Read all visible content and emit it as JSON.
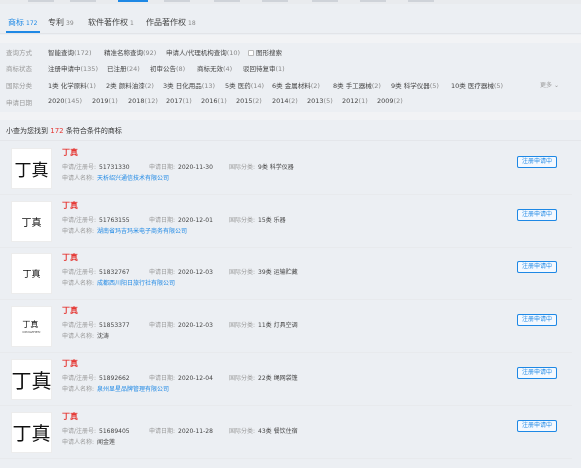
{
  "tabs": [
    {
      "label": "商标",
      "count": "172"
    },
    {
      "label": "专利",
      "count": "39"
    },
    {
      "label": "软件著作权",
      "count": "1"
    },
    {
      "label": "作品著作权",
      "count": "18"
    }
  ],
  "filters": {
    "query_mode": {
      "label": "查询方式",
      "options": [
        {
          "label": "智能查询",
          "count": "(172)"
        },
        {
          "label": "精准名称查询",
          "count": "(92)"
        },
        {
          "label": "申请人/代理机构查询",
          "count": "(10)"
        }
      ],
      "checkbox_label": "图形搜索"
    },
    "status": {
      "label": "商标状态",
      "options": [
        {
          "label": "注册申请中",
          "count": "(135)"
        },
        {
          "label": "已注册",
          "count": "(24)"
        },
        {
          "label": "初审公告",
          "count": "(8)"
        },
        {
          "label": "商标无效",
          "count": "(4)"
        },
        {
          "label": "驳回待复审",
          "count": "(1)"
        }
      ]
    },
    "class": {
      "label": "国际分类",
      "options": [
        {
          "label": "1类 化学原料",
          "count": "(1)"
        },
        {
          "label": "2类 颜料油漆",
          "count": "(2)"
        },
        {
          "label": "3类 日化用品",
          "count": "(13)"
        },
        {
          "label": "5类 医药",
          "count": "(14)"
        },
        {
          "label": "6类 金属材料",
          "count": "(2)"
        },
        {
          "label": "8类 手工器械",
          "count": "(2)"
        },
        {
          "label": "9类 科学仪器",
          "count": "(5)"
        },
        {
          "label": "10类 医疗器械",
          "count": "(5)"
        }
      ],
      "more": "更多"
    },
    "date": {
      "label": "申请日期",
      "options": [
        {
          "label": "2020",
          "count": "(145)"
        },
        {
          "label": "2019",
          "count": "(1)"
        },
        {
          "label": "2018",
          "count": "(12)"
        },
        {
          "label": "2017",
          "count": "(1)"
        },
        {
          "label": "2016",
          "count": "(1)"
        },
        {
          "label": "2015",
          "count": "(2)"
        },
        {
          "label": "2014",
          "count": "(2)"
        },
        {
          "label": "2013",
          "count": "(5)"
        },
        {
          "label": "2012",
          "count": "(1)"
        },
        {
          "label": "2009",
          "count": "(2)"
        }
      ]
    }
  },
  "summary": {
    "prefix": "小查为您找到",
    "count": "172",
    "suffix": "条符合条件的商标"
  },
  "field_labels": {
    "reg_no": "申请/注册号:",
    "apply_date": "申请日期:",
    "intl_class": "国际分类:",
    "applicant": "申请人名称:"
  },
  "results": [
    {
      "logo": "丁真",
      "logo_sub": "",
      "name": "丁真",
      "reg_no": "51731330",
      "apply_date": "2020-11-30",
      "intl_class": "9类 科学仪器",
      "applicant": "天析绍兴通信技术有限公司",
      "applicant_link": true,
      "status": "注册申请中"
    },
    {
      "logo": "丁真",
      "logo_sub": "",
      "name": "丁真",
      "reg_no": "51763155",
      "apply_date": "2020-12-01",
      "intl_class": "15类 乐器",
      "applicant": "湖南省玛吉玛米电子商务有限公司",
      "applicant_link": true,
      "status": "注册申请中"
    },
    {
      "logo": "丁真",
      "logo_sub": "",
      "name": "丁真",
      "reg_no": "51832767",
      "apply_date": "2020-12-03",
      "intl_class": "39类 运输贮藏",
      "applicant": "成都西川阳日旅行社有限公司",
      "applicant_link": true,
      "status": "注册申请中"
    },
    {
      "logo": "丁真",
      "logo_sub": "DINGZHEN",
      "name": "丁真",
      "reg_no": "51853377",
      "apply_date": "2020-12-03",
      "intl_class": "11类 灯具空调",
      "applicant": "沈涛",
      "applicant_link": false,
      "status": "注册申请中"
    },
    {
      "logo": "丁真",
      "logo_sub": "",
      "name": "丁真",
      "reg_no": "51892662",
      "apply_date": "2020-12-04",
      "intl_class": "22类 绳网袋篷",
      "applicant": "泉州显星品牌管理有限公司",
      "applicant_link": true,
      "status": "注册申请中"
    },
    {
      "logo": "丁真",
      "logo_sub": "",
      "name": "丁真",
      "reg_no": "51689405",
      "apply_date": "2020-11-28",
      "intl_class": "43类 餐饮住宿",
      "applicant": "闻金莲",
      "applicant_link": false,
      "status": "注册申请中"
    }
  ]
}
